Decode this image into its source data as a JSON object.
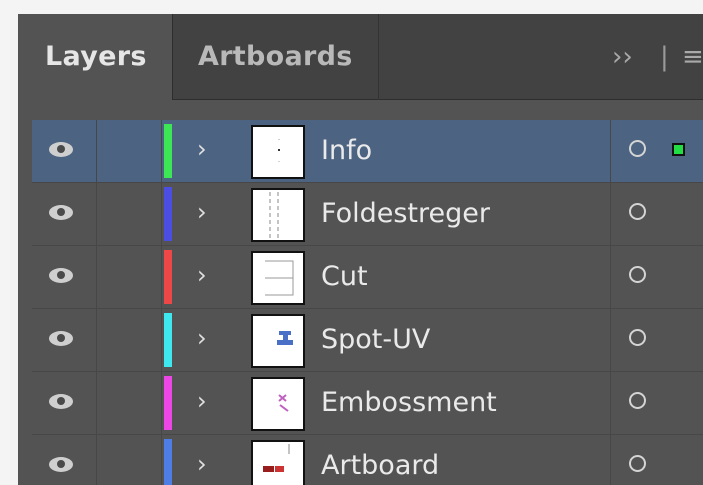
{
  "tabs": {
    "layers": "Layers",
    "artboards": "Artboards",
    "overflow": "››",
    "divider": "|",
    "menu": "≡"
  },
  "layers": [
    {
      "name": "Info",
      "color": "#3ce654",
      "selected": true,
      "thumb": "info-thumbnail"
    },
    {
      "name": "Foldestreger",
      "color": "#4b4de3",
      "selected": false,
      "thumb": "fold-lines-thumbnail"
    },
    {
      "name": "Cut",
      "color": "#ee4747",
      "selected": false,
      "thumb": "cut-thumbnail"
    },
    {
      "name": "Spot-UV",
      "color": "#3ee8ee",
      "selected": false,
      "thumb": "spot-uv-thumbnail"
    },
    {
      "name": "Embossment",
      "color": "#ec47e4",
      "selected": false,
      "thumb": "embossment-thumbnail"
    },
    {
      "name": "Artboard",
      "color": "#4d7de5",
      "selected": false,
      "thumb": "artboard-thumbnail"
    }
  ],
  "icons": {
    "visibility": "eye-icon",
    "expand": "chevron-right-icon",
    "target": "target-circle-icon",
    "selection": "selection-square-icon"
  }
}
